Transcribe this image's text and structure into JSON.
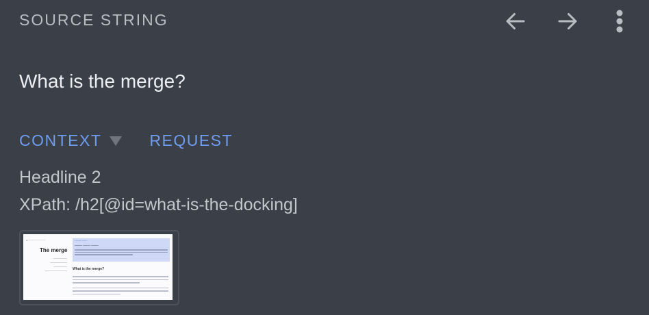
{
  "header": {
    "title": "SOURCE STRING",
    "back_icon": "arrow-left-icon",
    "forward_icon": "arrow-right-icon",
    "menu_icon": "more-vert-icon"
  },
  "source": {
    "text": "What is the merge?"
  },
  "tabs": [
    {
      "label": "CONTEXT",
      "has_caret": true
    },
    {
      "label": "REQUEST"
    }
  ],
  "context": {
    "type": "Headline 2",
    "xpath": "XPath: /h2[@id=what-is-the-docking]"
  },
  "thumbnail": {
    "page_title": "The merge",
    "section_heading": "What is the merge?"
  },
  "colors": {
    "background": "#3b3f48",
    "accent": "#6e9df0",
    "muted_text": "#b9bcc3"
  }
}
